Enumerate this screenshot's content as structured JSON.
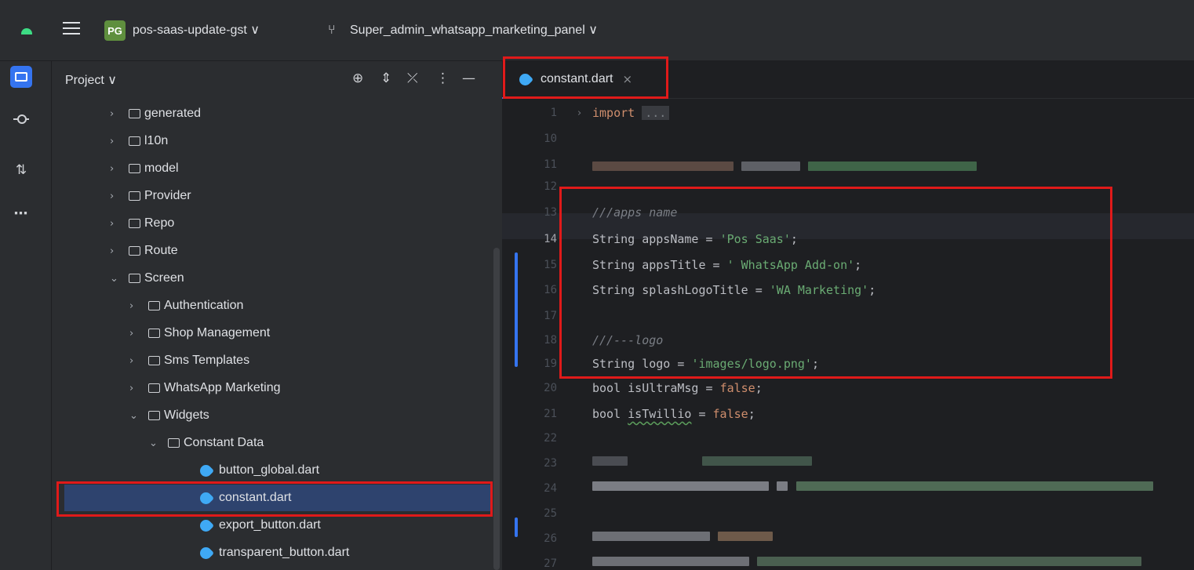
{
  "titlebar": {
    "project_badge": "PG",
    "project_name": "pos-saas-update-gst ∨",
    "branch_name": "Super_admin_whatsapp_marketing_panel ∨"
  },
  "panel": {
    "title": "Project ∨",
    "tree": [
      {
        "label": "generated",
        "type": "folder",
        "expanded": false,
        "depth": 0
      },
      {
        "label": "l10n",
        "type": "folder",
        "expanded": false,
        "depth": 0
      },
      {
        "label": "model",
        "type": "folder",
        "expanded": false,
        "depth": 0
      },
      {
        "label": "Provider",
        "type": "folder",
        "expanded": false,
        "depth": 0
      },
      {
        "label": "Repo",
        "type": "folder",
        "expanded": false,
        "depth": 0
      },
      {
        "label": "Route",
        "type": "folder",
        "expanded": false,
        "depth": 0
      },
      {
        "label": "Screen",
        "type": "folder",
        "expanded": true,
        "depth": 0
      },
      {
        "label": "Authentication",
        "type": "folder",
        "expanded": false,
        "depth": 1
      },
      {
        "label": "Shop Management",
        "type": "folder",
        "expanded": false,
        "depth": 1
      },
      {
        "label": "Sms Templates",
        "type": "folder",
        "expanded": false,
        "depth": 1
      },
      {
        "label": "WhatsApp Marketing",
        "type": "folder",
        "expanded": false,
        "depth": 1
      },
      {
        "label": "Widgets",
        "type": "folder",
        "expanded": true,
        "depth": 1
      },
      {
        "label": "Constant Data",
        "type": "folder",
        "expanded": true,
        "depth": 2
      },
      {
        "label": "button_global.dart",
        "type": "dart",
        "depth": 3
      },
      {
        "label": "constant.dart",
        "type": "dart",
        "depth": 3,
        "selected": true
      },
      {
        "label": "export_button.dart",
        "type": "dart",
        "depth": 3
      },
      {
        "label": "transparent_button.dart",
        "type": "dart",
        "depth": 3
      }
    ]
  },
  "editor": {
    "tab_label": "constant.dart",
    "tab_close": "×",
    "line_numbers": [
      "1",
      "10",
      "11",
      "12",
      "13",
      "14",
      "15",
      "16",
      "17",
      "18",
      "19",
      "20",
      "21",
      "22",
      "23",
      "24",
      "25",
      "26",
      "27"
    ],
    "current_line": "14",
    "code": {
      "import_kw": "import",
      "import_fold": "...",
      "c13": "///apps name",
      "l14_a": "String appsName = ",
      "l14_s": "'Pos Saas'",
      "l15_a": "String appsTitle = ",
      "l15_s": "' WhatsApp Add-on'",
      "l16_a": "String splashLogoTitle = ",
      "l16_s": "'WA Marketing'",
      "c18": "///---logo",
      "l19_a": "String logo = ",
      "l19_s": "'images/logo.png'",
      "l20_a": "bool isUltraMsg = ",
      "l20_k": "false",
      "l21_a": "bool ",
      "l21_id": "isTwillio",
      "l21_b": " = ",
      "l21_k": "false",
      "semi": ";"
    }
  }
}
